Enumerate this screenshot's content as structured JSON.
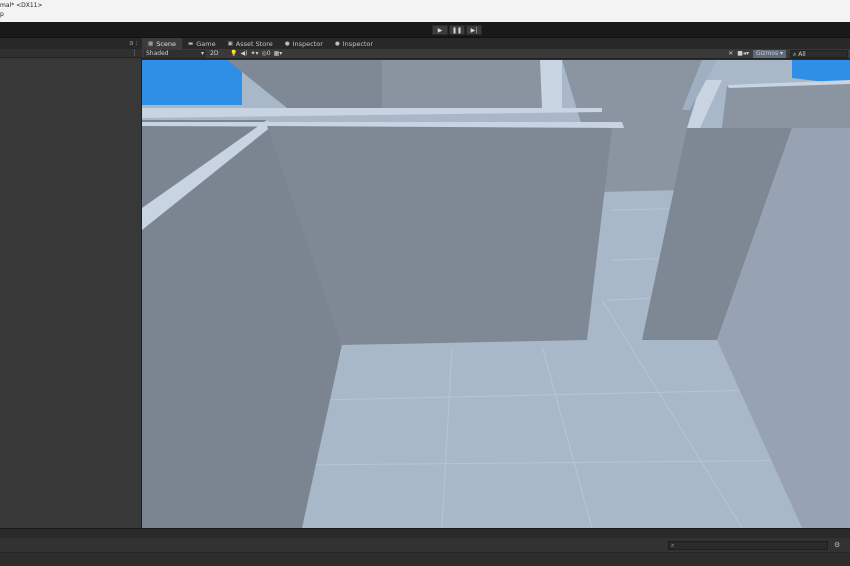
{
  "window": {
    "title_line1": "mal* <DX11>",
    "title_line2": "p"
  },
  "toolbar": {
    "play_icon": "▶",
    "pause_icon": "❚❚",
    "step_icon": "▶|"
  },
  "hierarchy": {
    "lock_icon": "a :",
    "menu_icon": "⋮"
  },
  "scene_tabs": [
    {
      "label": "Scene",
      "icon": "grid-icon",
      "glyph": "▦"
    },
    {
      "label": "Game",
      "icon": "gamepad-icon",
      "glyph": "▬"
    },
    {
      "label": "Asset Store",
      "icon": "store-icon",
      "glyph": "▣"
    },
    {
      "label": "Inspector",
      "icon": "info-icon",
      "glyph": "●"
    },
    {
      "label": "Inspector",
      "icon": "info-icon",
      "glyph": "●"
    }
  ],
  "scene_toolbar": {
    "shading_mode": "Shaded",
    "mode_2d": "2D",
    "gizmos_label": "Gizmos",
    "search_placeholder": "All"
  },
  "console": {
    "search_icon": "🔍"
  },
  "colors": {
    "sky": "#2f8fe6",
    "floor": "#a9b8c9",
    "wall_dark": "#7b8591",
    "wall_mid": "#8b95a2",
    "wall_light": "#97a3b2",
    "edge": "#c8d4e2"
  }
}
